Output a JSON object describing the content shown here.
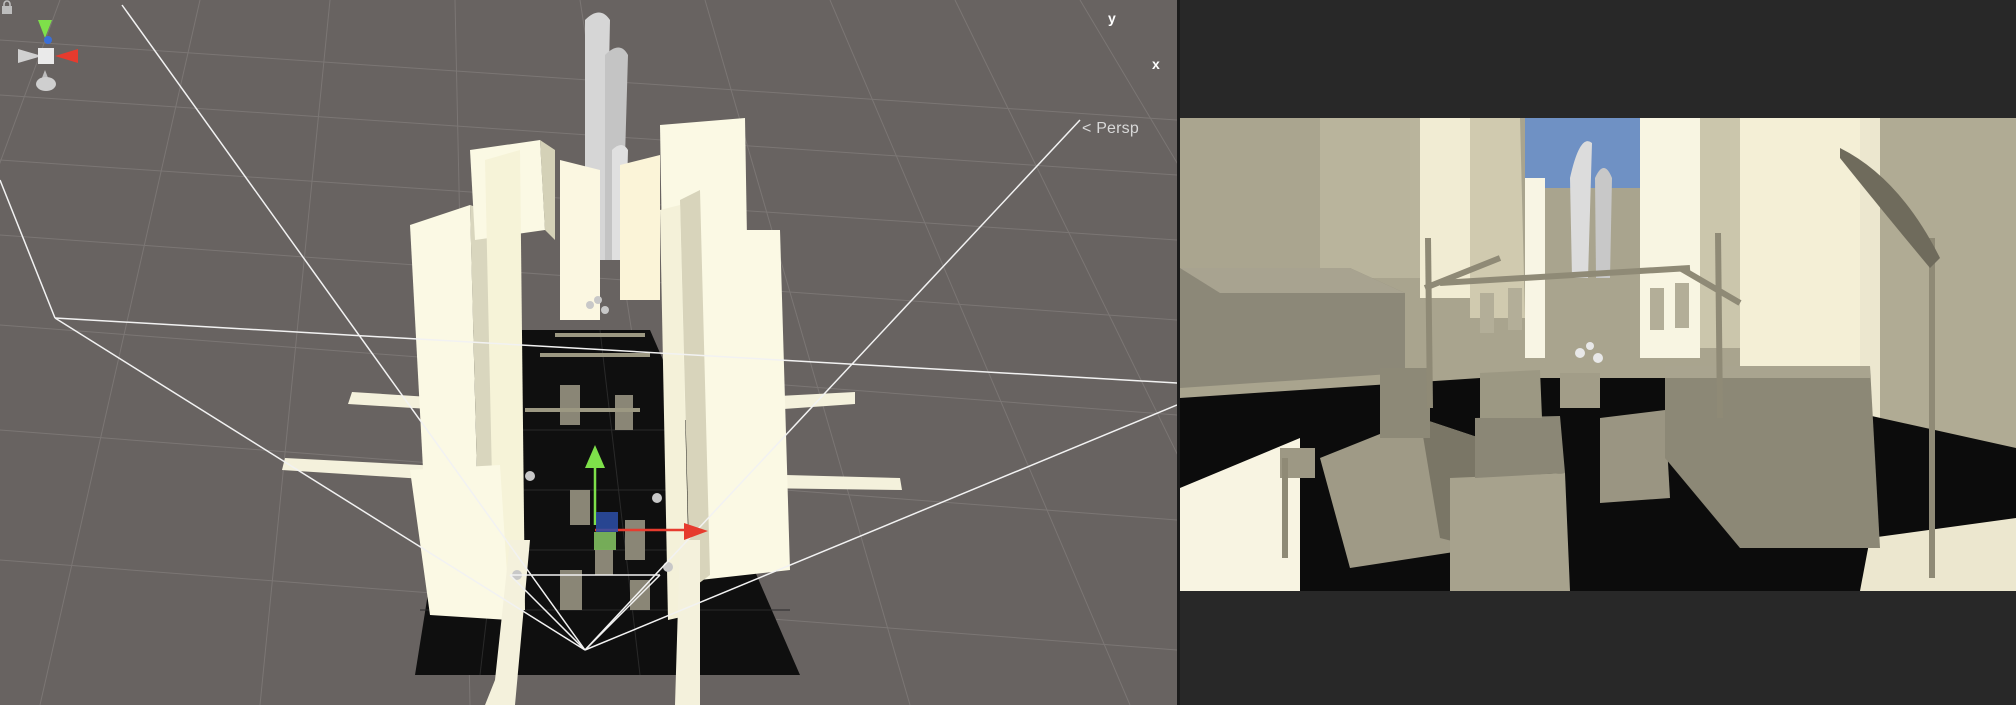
{
  "scene_view": {
    "projection_label": "< Persp",
    "gizmo": {
      "y_label": "y",
      "x_label": "x",
      "colors": {
        "y_axis": "#7ee04a",
        "x_axis": "#e63b2e",
        "z_axis": "#3a6fd8"
      }
    },
    "grid_color": "#7a7573",
    "background": "#686361"
  },
  "game_view": {
    "background": "#282828",
    "sky_color": "#6f91c4",
    "building_color": "#a9a48e"
  }
}
